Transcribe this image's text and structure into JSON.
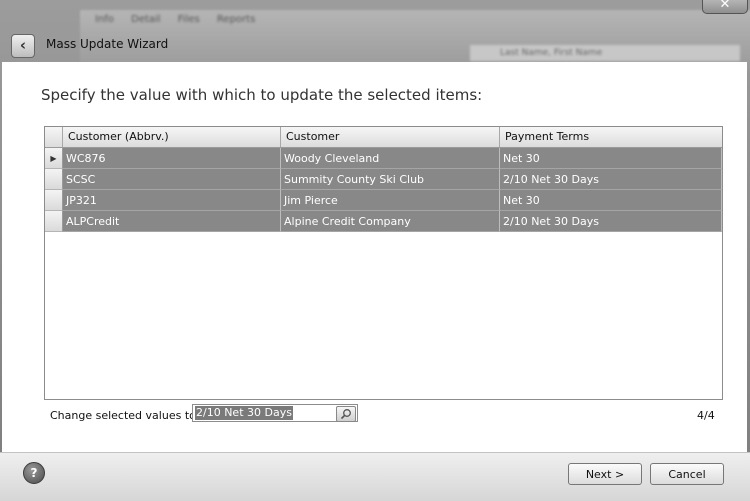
{
  "window": {
    "title": "Mass Update Wizard",
    "close_glyph": "✕"
  },
  "background_app": {
    "tabs": [
      "Info",
      "Detail",
      "Files",
      "Reports"
    ],
    "search_text": "Last Name, First Name"
  },
  "main": {
    "prompt": "Specify the value with which to update the selected items:",
    "grid": {
      "columns": [
        "Customer (Abbrv.)",
        "Customer",
        "Payment Terms"
      ],
      "rows": [
        {
          "abbrv": "WC876",
          "customer": "Woody Cleveland",
          "terms": "Net 30",
          "current": true
        },
        {
          "abbrv": "SCSC",
          "customer": "Summity County Ski Club",
          "terms": "2/10 Net 30 Days",
          "current": false
        },
        {
          "abbrv": "JP321",
          "customer": "Jim Pierce",
          "terms": "Net 30",
          "current": false
        },
        {
          "abbrv": "ALPCredit",
          "customer": "Alpine Credit Company",
          "terms": "2/10 Net 30 Days",
          "current": false
        }
      ],
      "current_row_indicator": "▶"
    },
    "change_label": "Change selected values to:",
    "change_value": "2/10 Net 30 Days",
    "step_counter": "4/4"
  },
  "buttons": {
    "help": "?",
    "next": "Next >",
    "cancel": "Cancel"
  },
  "colors": {
    "selected_row_bg": "#888888",
    "selected_row_text": "#ffffff"
  }
}
